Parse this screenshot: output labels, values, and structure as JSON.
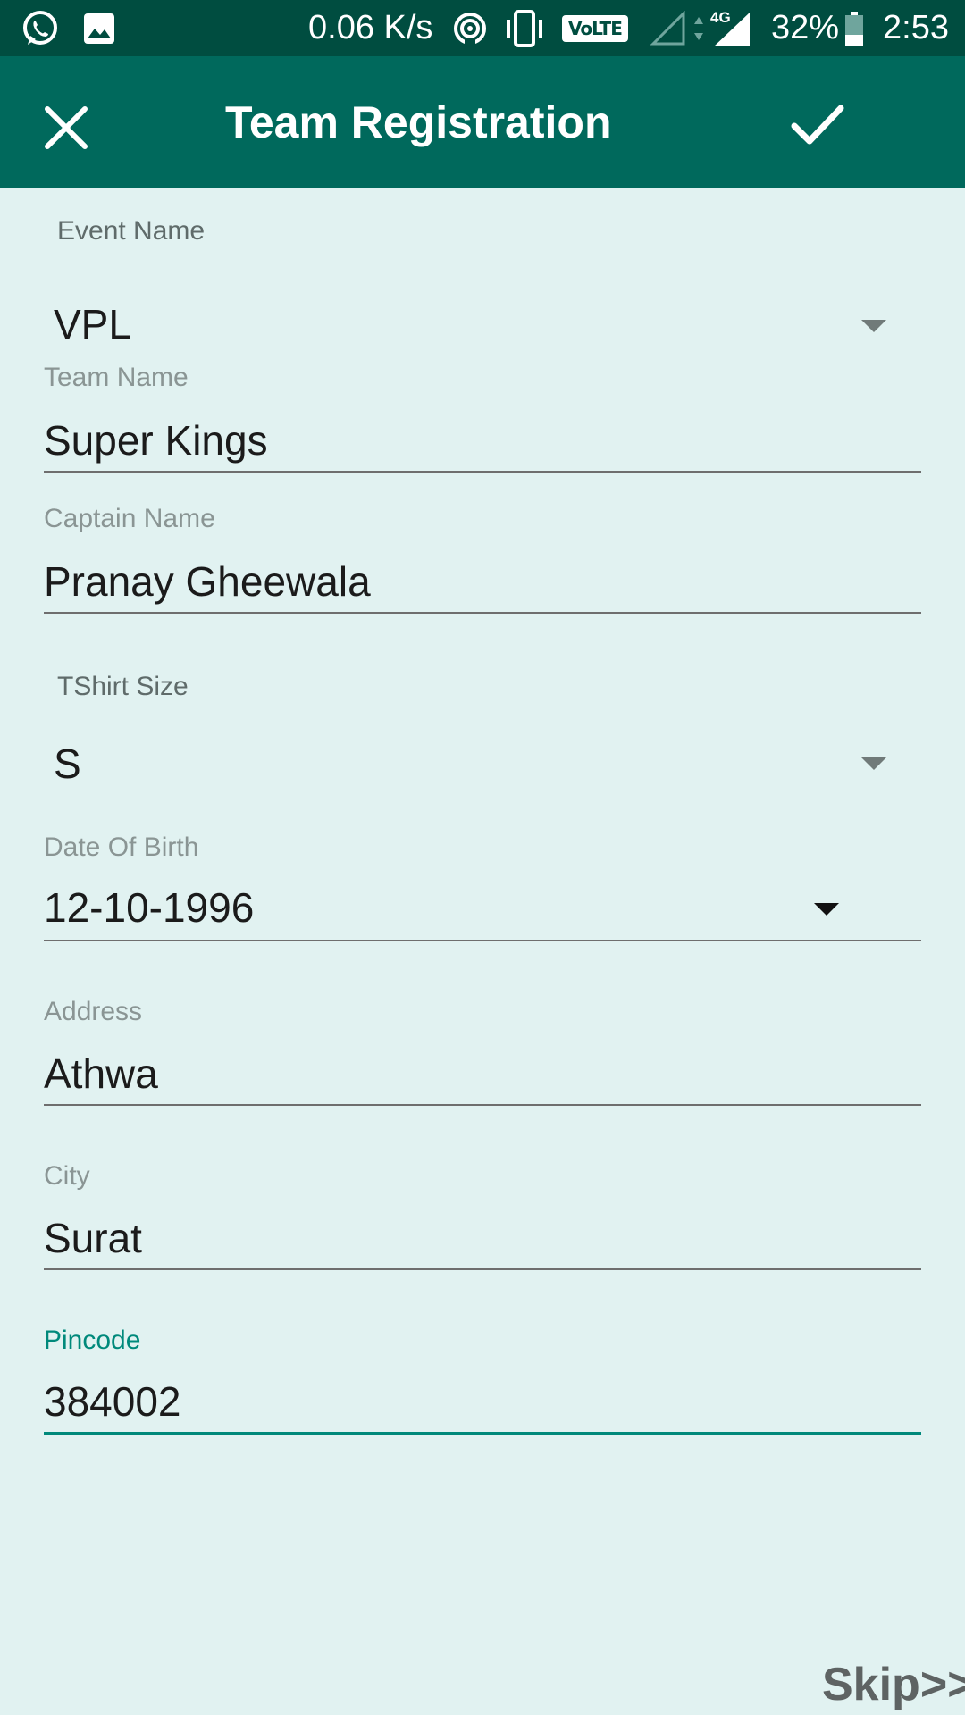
{
  "status_bar": {
    "speed": "0.06 K/s",
    "volte": "VoLTE",
    "network": "4G",
    "battery": "32%",
    "time": "2:53"
  },
  "toolbar": {
    "title": "Team Registration"
  },
  "form": {
    "event_name": {
      "label": "Event Name",
      "value": "VPL"
    },
    "team_name": {
      "label": "Team Name",
      "value": "Super Kings"
    },
    "captain_name": {
      "label": "Captain Name",
      "value": "Pranay Gheewala"
    },
    "tshirt_size": {
      "label": "TShirt Size",
      "value": "S"
    },
    "date_of_birth": {
      "label": "Date Of Birth",
      "value": "12-10-1996"
    },
    "address": {
      "label": "Address",
      "value": "Athwa"
    },
    "city": {
      "label": "City",
      "value": "Surat"
    },
    "pincode": {
      "label": "Pincode",
      "value": "384002"
    }
  },
  "skip_label": "Skip>>",
  "colors": {
    "status_bar": "#004d40",
    "toolbar": "#00695c",
    "background": "#e1f2f1",
    "accent": "#00897b"
  }
}
